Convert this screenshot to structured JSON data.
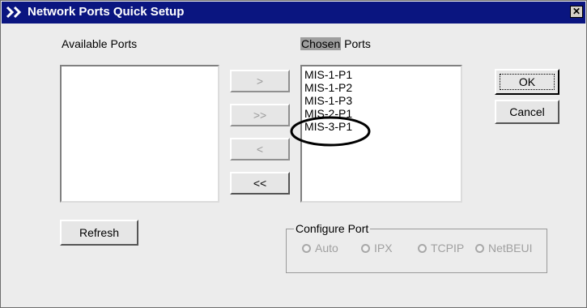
{
  "window": {
    "title": "Network Ports Quick Setup",
    "close_glyph": "✕"
  },
  "available": {
    "label": "Available Ports",
    "items": []
  },
  "chosen": {
    "label_highlight": "Chosen",
    "label_rest": " Ports",
    "items": [
      "MIS-1-P1",
      "MIS-1-P2",
      "MIS-1-P3",
      "MIS-2-P1",
      "MIS-3-P1"
    ]
  },
  "transfer_buttons": {
    "add": ">",
    "add_all": ">>",
    "remove": "<",
    "remove_all": "<<"
  },
  "buttons": {
    "ok": "OK",
    "cancel": "Cancel",
    "refresh": "Refresh"
  },
  "configure_port": {
    "legend": "Configure Port",
    "options": [
      "Auto",
      "IPX",
      "TCPIP",
      "NetBEUI"
    ]
  },
  "colors": {
    "titlebar": "#0a1580",
    "chosen_highlight": "#9e9e9e",
    "annotation": "#000000"
  }
}
